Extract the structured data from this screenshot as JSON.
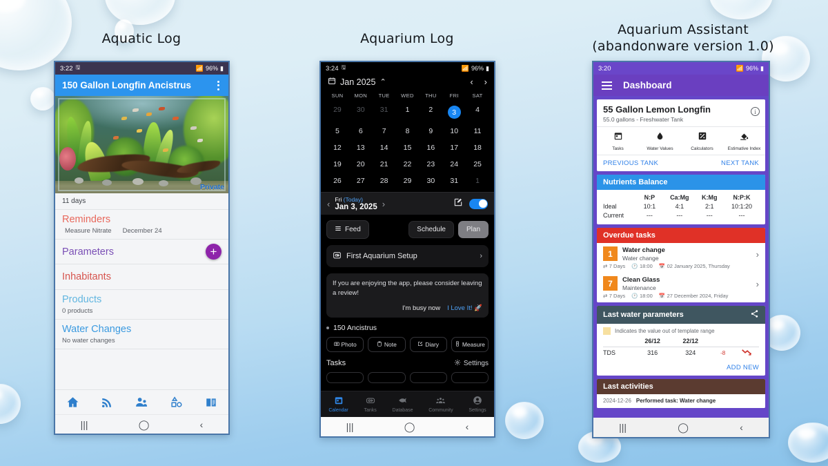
{
  "captions": {
    "left": "Aquatic Log",
    "middle": "Aquarium Log",
    "right": "Aquarium Assistant\n(abandonware version 1.0)"
  },
  "phone1": {
    "status": {
      "time": "3:22",
      "battery": "96%"
    },
    "header": {
      "title": "150 Gallon Longfin Ancistrus",
      "menu_icon": "kebab-menu-icon"
    },
    "photo": {
      "badge": "Private"
    },
    "age_row": "11 days",
    "sections": [
      {
        "title": "Reminders",
        "color": "#e8685c",
        "items": [
          "Measure Nitrate",
          "December 24"
        ]
      },
      {
        "title": "Parameters",
        "color": "#7a4fb5",
        "action": "+"
      },
      {
        "title": "Inhabitants",
        "color": "#d6544e"
      },
      {
        "title": "Products",
        "color": "#62b6e0",
        "sub": "0 products"
      },
      {
        "title": "Water Changes",
        "color": "#3b9ae0",
        "sub": "No water changes"
      }
    ],
    "tabs": [
      {
        "name": "home-icon"
      },
      {
        "name": "feed-icon"
      },
      {
        "name": "community-icon"
      },
      {
        "name": "shapes-icon"
      },
      {
        "name": "book-icon"
      }
    ]
  },
  "phone2": {
    "status": {
      "time": "3:24",
      "battery": "96%"
    },
    "calendar": {
      "month_label": "Jan 2025",
      "collapse_icon": "chevron-up-icon",
      "prev_icon": "chevron-left-icon",
      "next_icon": "chevron-right-icon",
      "dow": [
        "SUN",
        "MON",
        "TUE",
        "WED",
        "THU",
        "FRI",
        "SAT"
      ],
      "weeks": [
        [
          {
            "d": "29",
            "mut": true
          },
          {
            "d": "30",
            "mut": true
          },
          {
            "d": "31",
            "mut": true
          },
          {
            "d": "1"
          },
          {
            "d": "2"
          },
          {
            "d": "3",
            "sel": true
          },
          {
            "d": "4"
          }
        ],
        [
          {
            "d": "5"
          },
          {
            "d": "6"
          },
          {
            "d": "7"
          },
          {
            "d": "8"
          },
          {
            "d": "9"
          },
          {
            "d": "10"
          },
          {
            "d": "11"
          }
        ],
        [
          {
            "d": "12"
          },
          {
            "d": "13"
          },
          {
            "d": "14"
          },
          {
            "d": "15"
          },
          {
            "d": "16"
          },
          {
            "d": "17"
          },
          {
            "d": "18"
          }
        ],
        [
          {
            "d": "19"
          },
          {
            "d": "20"
          },
          {
            "d": "21"
          },
          {
            "d": "22"
          },
          {
            "d": "23"
          },
          {
            "d": "24"
          },
          {
            "d": "25"
          }
        ],
        [
          {
            "d": "26"
          },
          {
            "d": "27"
          },
          {
            "d": "28"
          },
          {
            "d": "29"
          },
          {
            "d": "30"
          },
          {
            "d": "31"
          },
          {
            "d": "1",
            "mut": true
          }
        ]
      ]
    },
    "daybar": {
      "dow": "Fri",
      "today": "(Today)",
      "date": "Jan 3, 2025",
      "edit_icon": "edit-icon",
      "toggle_on": true
    },
    "buttons": {
      "feed": "Feed",
      "schedule": "Schedule",
      "plan": "Plan"
    },
    "setup_card": {
      "label": "First Aquarium Setup",
      "icon": "fish-tank-icon",
      "arrow": "›"
    },
    "review_card": {
      "text": "If you are enjoying the app, please consider leaving a review!",
      "busy": "I'm busy now",
      "love": "I Love It!",
      "love_icon": "rocket-icon"
    },
    "tank": {
      "name": "150 Ancistrus"
    },
    "chips": [
      {
        "label": "Photo",
        "icon": "camera-icon"
      },
      {
        "label": "Note",
        "icon": "note-icon"
      },
      {
        "label": "Diary",
        "icon": "diary-icon"
      },
      {
        "label": "Measure",
        "icon": "measure-icon"
      }
    ],
    "tasks_row": {
      "label": "Tasks",
      "settings": "Settings",
      "settings_icon": "gear-icon"
    },
    "tabs": [
      {
        "label": "Calendar",
        "icon": "calendar-icon",
        "active": true
      },
      {
        "label": "Tanks",
        "icon": "tank-icon"
      },
      {
        "label": "Database",
        "icon": "fish-icon"
      },
      {
        "label": "Community",
        "icon": "people-icon"
      },
      {
        "label": "Settings",
        "icon": "account-icon"
      }
    ]
  },
  "phone3": {
    "status": {
      "time": "3:20",
      "battery": "96%"
    },
    "header": {
      "title": "Dashboard",
      "menu_icon": "hamburger-icon"
    },
    "tank_card": {
      "name": "55 Gallon Lemon Longfin",
      "sub": "55.0 gallons - Freshwater Tank",
      "info_icon": "info-icon",
      "quick": [
        {
          "label": "Tasks",
          "icon": "calendar-icon"
        },
        {
          "label": "Water Values",
          "icon": "drop-icon"
        },
        {
          "label": "Calculators",
          "icon": "calculator-icon"
        },
        {
          "label": "Estimative Index",
          "icon": "fertilizer-icon"
        }
      ],
      "prev": "PREVIOUS TANK",
      "next": "NEXT TANK"
    },
    "nutrients": {
      "title": "Nutrients Balance",
      "columns": [
        "N:P",
        "Ca:Mg",
        "K:Mg",
        "N:P:K"
      ],
      "rows": [
        {
          "label": "Ideal",
          "values": [
            "10:1",
            "4:1",
            "2:1",
            "10:1:20"
          ]
        },
        {
          "label": "Current",
          "values": [
            "---",
            "---",
            "---",
            "---"
          ]
        }
      ]
    },
    "overdue": {
      "title": "Overdue tasks",
      "tasks": [
        {
          "num": "1",
          "title": "Water change",
          "type": "Water change",
          "repeat": "7 Days",
          "time": "18:00",
          "date": "02 January 2025, Thursday"
        },
        {
          "num": "7",
          "title": "Clean Glass",
          "type": "Maintenance",
          "repeat": "7 Days",
          "time": "18:00",
          "date": "27 December 2024, Friday"
        }
      ]
    },
    "water_params": {
      "title": "Last water parameters",
      "share_icon": "share-icon",
      "legend": "Indicates the value out of template range",
      "columns": [
        "26/12",
        "22/12"
      ],
      "rows": [
        {
          "label": "TDS",
          "v1": "316",
          "v2": "324",
          "delta": "-8",
          "trend": "down"
        }
      ],
      "add_new": "ADD NEW"
    },
    "activities": {
      "title": "Last activities",
      "items": [
        {
          "date": "2024-12-26",
          "text": "Performed task: Water change"
        }
      ]
    }
  },
  "colors": {
    "blue": "#2c94ee",
    "purple": "#6a3fc0",
    "red": "#e03127",
    "orange": "#f0881c",
    "teal": "#3f5660",
    "brown": "#5b3b30"
  }
}
